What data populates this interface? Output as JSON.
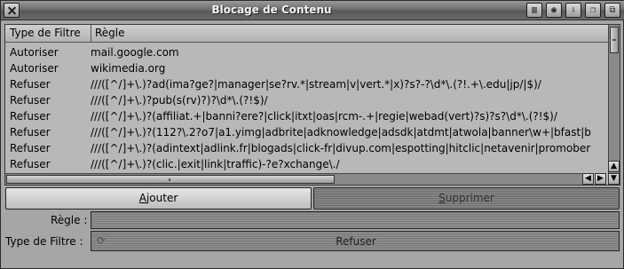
{
  "window": {
    "title": "Blocage de Contenu",
    "title_buttons": [
      "iconify-icon",
      "snapshot-icon",
      "popup-icon",
      "depth-icon",
      "zoom-icon"
    ]
  },
  "list": {
    "columns": [
      "Type de Filtre",
      "Règle"
    ],
    "rows": [
      {
        "type": "Autoriser",
        "rule": "mail.google.com"
      },
      {
        "type": "Autoriser",
        "rule": "wikimedia.org"
      },
      {
        "type": "Refuser",
        "rule": "///([^/]+\\.)?ad(ima?ge?|manager|se?rv.*|stream|v|vert.*|x)?s?-?\\d*\\.(?!.+\\.edu|jp/|$)/"
      },
      {
        "type": "Refuser",
        "rule": "///([^/]+\\.)?pub(s(rv)?)?\\d*\\.(?!$)/"
      },
      {
        "type": "Refuser",
        "rule": "///([^/]+\\.)?(affiliat.+|banni?ere?|click|itxt|oas|rcm-.+|regie|webad(vert)?s)?s?\\d*\\.(?!$)/"
      },
      {
        "type": "Refuser",
        "rule": "///([^/]+\\.)?(112?\\.2?o7|a1.yimg|adbrite|adknowledge|adsdk|atdmt|atwola|banner\\w+|bfast|b"
      },
      {
        "type": "Refuser",
        "rule": "///([^/]+\\.)?(adintext|adlink.fr|blogads|click-fr|divup.com|espotting|hitclic|netavenir|promober"
      },
      {
        "type": "Refuser",
        "rule": "///([^/]+\\.)?(clic.|exit|link|traffic)-?e?xchange\\./"
      }
    ]
  },
  "buttons": {
    "add": {
      "underlined": "A",
      "rest": "jouter"
    },
    "delete": {
      "underlined": "S",
      "rest": "upprimer"
    }
  },
  "form": {
    "rule_label": "Règle :",
    "rule_value": "",
    "filter_type_label": "Type de Filtre :",
    "filter_type_value": "Refuser"
  }
}
